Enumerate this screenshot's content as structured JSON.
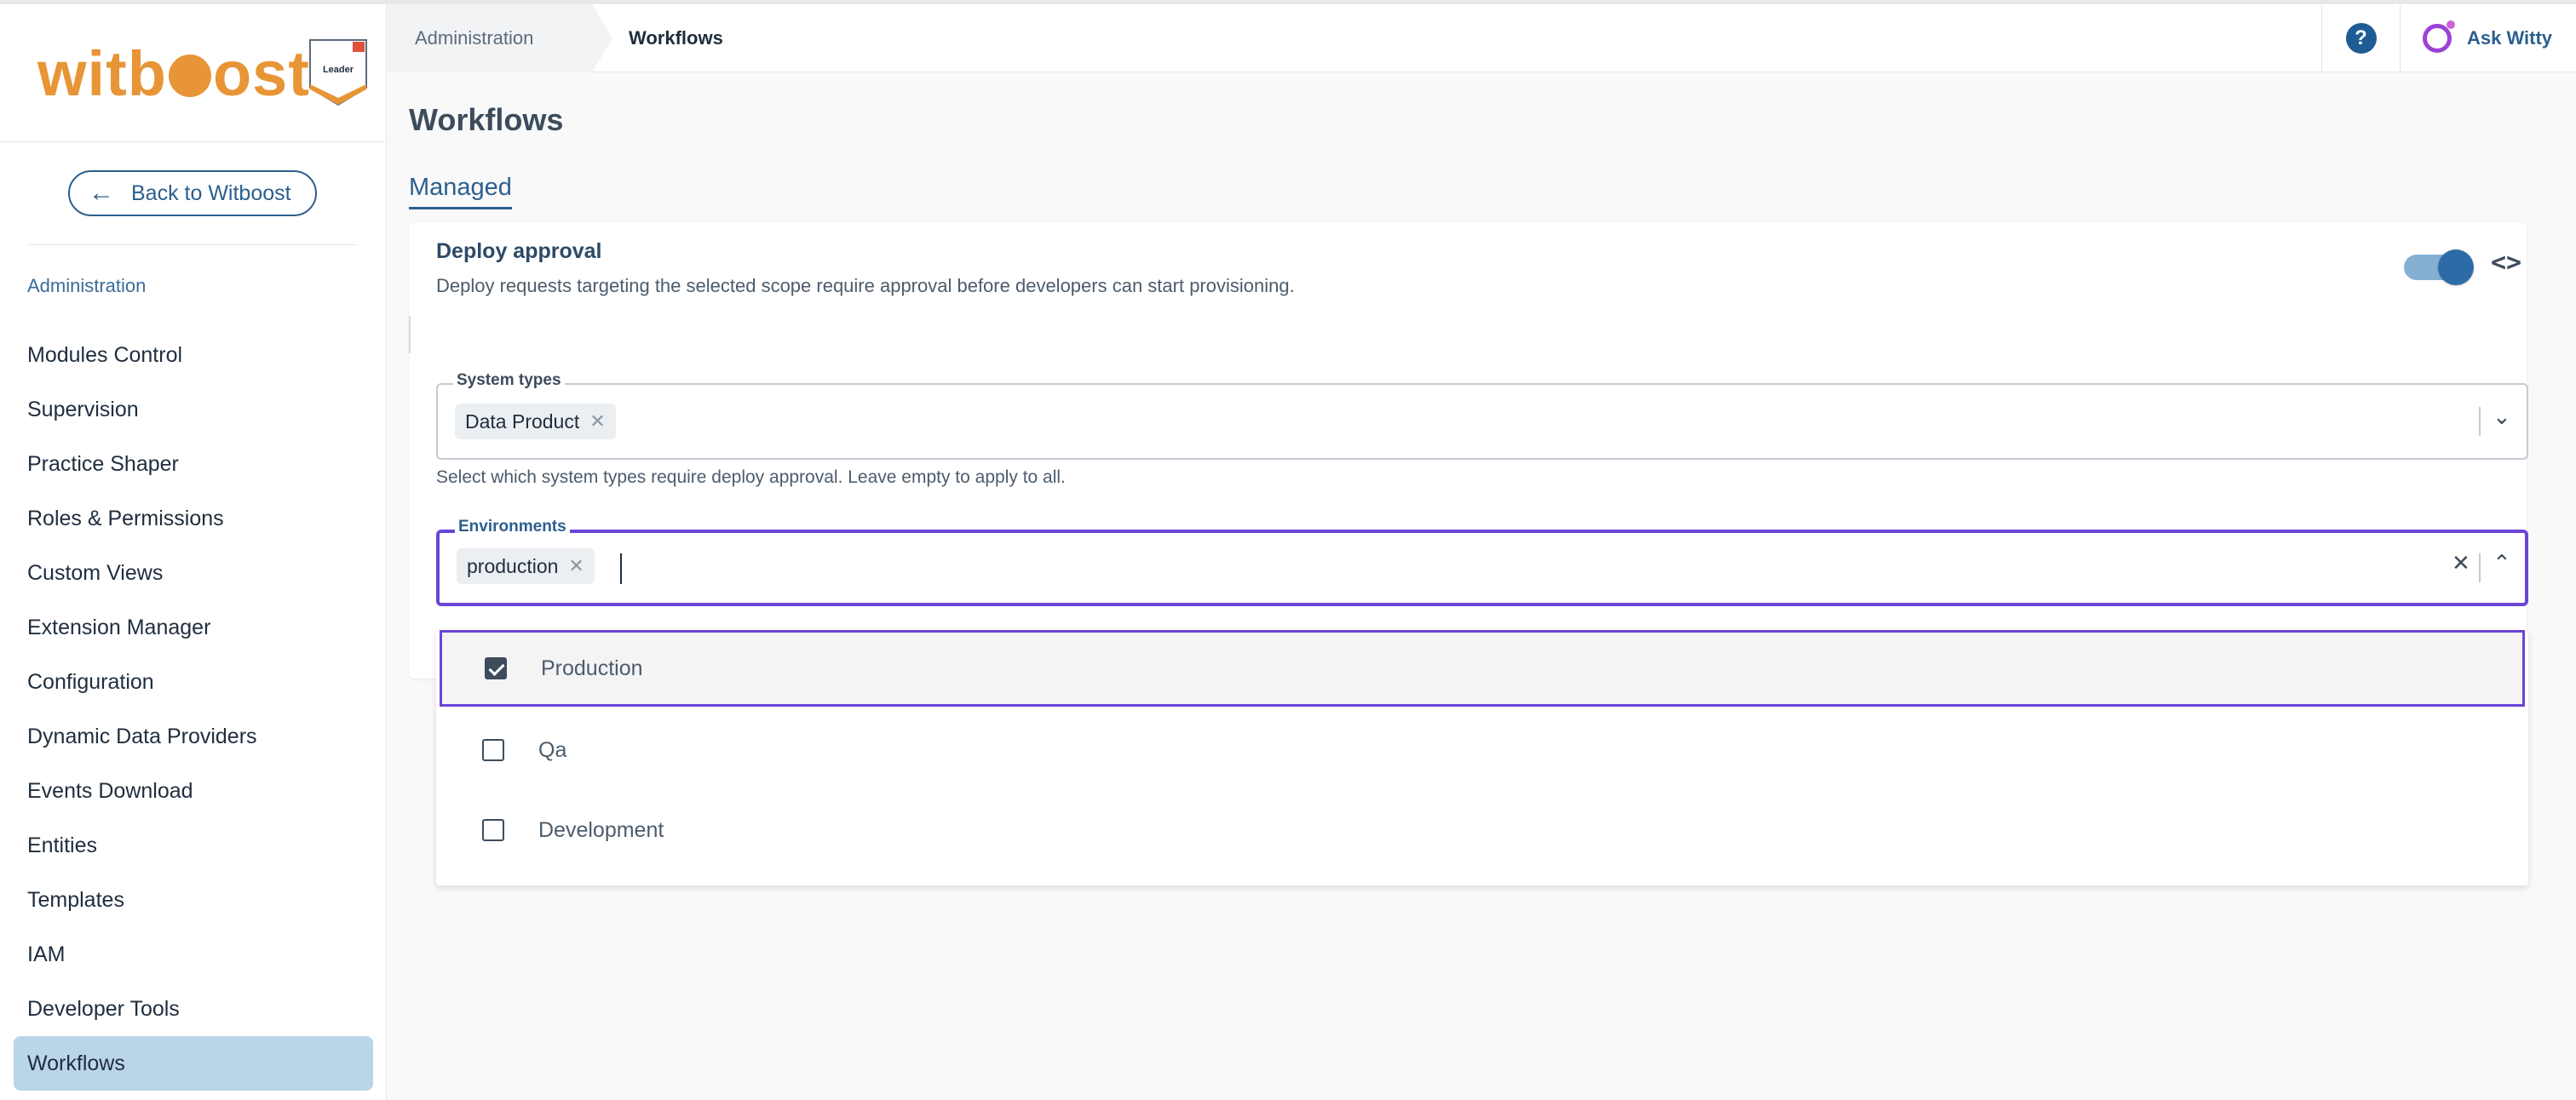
{
  "brand": {
    "logo_text": "witboost",
    "badge_text": "Leader",
    "accent_color": "#e79536"
  },
  "sidebar": {
    "back_label": "Back to Witboost",
    "section_label": "Administration",
    "items": [
      {
        "label": "Modules Control"
      },
      {
        "label": "Supervision"
      },
      {
        "label": "Practice Shaper"
      },
      {
        "label": "Roles & Permissions"
      },
      {
        "label": "Custom Views"
      },
      {
        "label": "Extension Manager"
      },
      {
        "label": "Configuration"
      },
      {
        "label": "Dynamic Data Providers"
      },
      {
        "label": "Events Download"
      },
      {
        "label": "Entities"
      },
      {
        "label": "Templates"
      },
      {
        "label": "IAM"
      },
      {
        "label": "Developer Tools"
      },
      {
        "label": "Workflows",
        "active": true
      }
    ]
  },
  "header": {
    "breadcrumb": [
      "Administration",
      "Workflows"
    ],
    "help_icon": "question-circle-icon",
    "ask_label": "Ask Witty"
  },
  "page": {
    "title": "Workflows",
    "tab_label": "Managed"
  },
  "card": {
    "title": "Deploy approval",
    "description": "Deploy requests targeting the selected scope require approval before developers can start provisioning.",
    "toggle_on": true,
    "system_types": {
      "label": "System types",
      "chips": [
        "Data Product"
      ],
      "help": "Select which system types require deploy approval. Leave empty to apply to all."
    },
    "environments": {
      "label": "Environments",
      "chips": [
        "production"
      ]
    }
  },
  "dropdown": {
    "options": [
      {
        "label": "Production",
        "checked": true
      },
      {
        "label": "Qa",
        "checked": false
      },
      {
        "label": "Development",
        "checked": false
      }
    ]
  },
  "colors": {
    "primary": "#2c5f8f",
    "focus": "#6b45d6",
    "active_nav": "#b9d6e9"
  }
}
